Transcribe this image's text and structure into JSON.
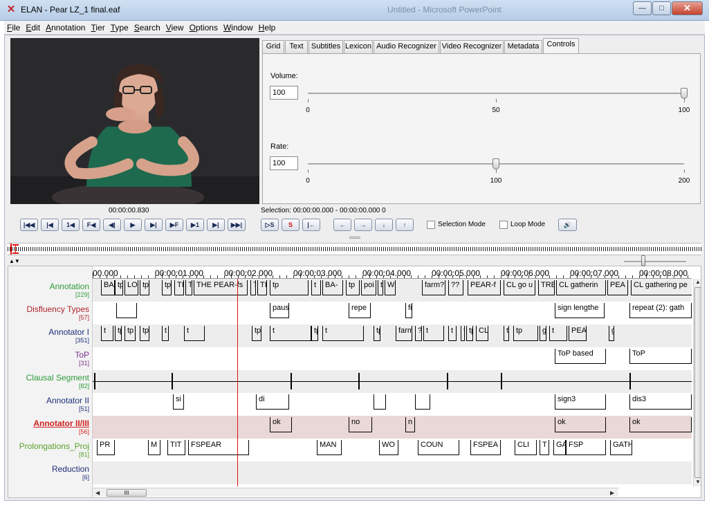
{
  "window": {
    "title": "ELAN - Pear LZ_1 final.eaf",
    "background_title": "Untitled - Microsoft PowerPoint",
    "min_glyph": "—",
    "max_glyph": "□",
    "close_glyph": "✕",
    "app_icon_glyph": "✕"
  },
  "menu": [
    "File",
    "Edit",
    "Annotation",
    "Tier",
    "Type",
    "Search",
    "View",
    "Options",
    "Window",
    "Help"
  ],
  "tabs": [
    {
      "label": "Grid"
    },
    {
      "label": "Text"
    },
    {
      "label": "Subtitles"
    },
    {
      "label": "Lexicon"
    },
    {
      "label": "Audio Recognizer"
    },
    {
      "label": "Video Recognizer"
    },
    {
      "label": "Metadata"
    },
    {
      "label": "Controls",
      "active": true
    }
  ],
  "controls": {
    "volume": {
      "label": "Volume:",
      "value": "100",
      "min": "0",
      "mid": "50",
      "max": "100",
      "level": 100
    },
    "rate": {
      "label": "Rate:",
      "value": "100",
      "min": "0",
      "mid": "100",
      "max": "200",
      "level": 50
    }
  },
  "media_time": "00:00:00.830",
  "selection": "Selection: 00:00:00.000 - 00:00:00.000  0",
  "transport": {
    "buttons": [
      "|◀◀",
      "|◀",
      "1◀",
      "F◀",
      "◀|",
      "▶",
      "▶|",
      "▶F",
      "▶1",
      "▶|",
      "▶▶|"
    ],
    "selection_buttons": [
      "▷S",
      "S",
      "|←"
    ],
    "nav_buttons": [
      "←",
      "→",
      "↓",
      "↑"
    ],
    "volume_icon": "🔊"
  },
  "modes": {
    "selection": "Selection Mode",
    "loop": "Loop Mode"
  },
  "ruler": [
    "00.000",
    "00:00:01.000",
    "00:00:02.000",
    "00:00:03.000",
    "00:00:04.000",
    "00:00:05.000",
    "00:00:06.000",
    "00:00:07.000",
    "00:00:08.000"
  ],
  "tiers": [
    {
      "name": "Annotation",
      "count": "[229]",
      "color": "#2e9a3a",
      "annotations": [
        "BA",
        "tp",
        "LO",
        "tp",
        "tp",
        "TI",
        "T",
        "THE PEAR-fs",
        "T",
        "TI",
        "tp",
        "t",
        "BA-",
        "tp",
        "poi",
        "t",
        "W",
        "farm?",
        "??",
        "PEAR-f",
        "CL go u",
        "TRE",
        "CL gatherin",
        "PEA",
        "CL gathering pe"
      ]
    },
    {
      "name": "Disfluency Types",
      "count": "[57]",
      "color": "#b0232a",
      "annotations": [
        "",
        "paus",
        "repe",
        "fi",
        "sign lengthe",
        "repeat (2): gath"
      ]
    },
    {
      "name": "Annotator I",
      "count": "[351]",
      "color": "#1c2f7a",
      "annotations": [
        "t",
        "tp",
        "tp",
        "tp",
        "t",
        "t",
        "tp",
        "t",
        "tp",
        "t",
        "tp",
        "farm",
        "?",
        "t",
        "t",
        "fs PE",
        "tp",
        "CL--cl",
        "tr",
        "tp",
        "gathering",
        "t",
        "PEA",
        "gathering pea"
      ]
    },
    {
      "name": "ToP",
      "count": "[31]",
      "color": "#7b2d8e",
      "annotations": [
        "ToP based",
        "ToP"
      ]
    },
    {
      "name": "Clausal Segment",
      "count": "[82]",
      "color": "#2e9a3a",
      "annotations": []
    },
    {
      "name": "Annotator II",
      "count": "[51]",
      "color": "#1c2f7a",
      "annotations": [
        "si",
        "di",
        "",
        "",
        "sign3",
        "dis3"
      ]
    },
    {
      "name": "Annotator II/III",
      "count": "[56]",
      "color": "#d11f1f",
      "annotations": [
        "ok",
        "no",
        "n",
        "ok",
        "ok"
      ]
    },
    {
      "name": "Prolongations_Proj",
      "count": "[81]",
      "color": "#5aa12c",
      "annotations": [
        "PR",
        "M",
        "TIT",
        "FSPEAR",
        "MAN",
        "WO",
        "COUN",
        "FSPEA",
        "CLI",
        "T",
        "GATHERI",
        "FSP",
        "GATHERINGF"
      ]
    },
    {
      "name": "Reduction",
      "count": "[6]",
      "color": "#1c2f7a",
      "annotations": []
    }
  ],
  "scroll": {
    "h_thumb_glyph": "III",
    "left_arrow": "◀",
    "right_arrow": "▶",
    "up_arrow": "▲",
    "down_arrow": "▼"
  },
  "colors": {
    "crosshair": "#dd1111",
    "active_tier_bg": "#ead7d7",
    "title_gradient": "#b7cde6"
  }
}
